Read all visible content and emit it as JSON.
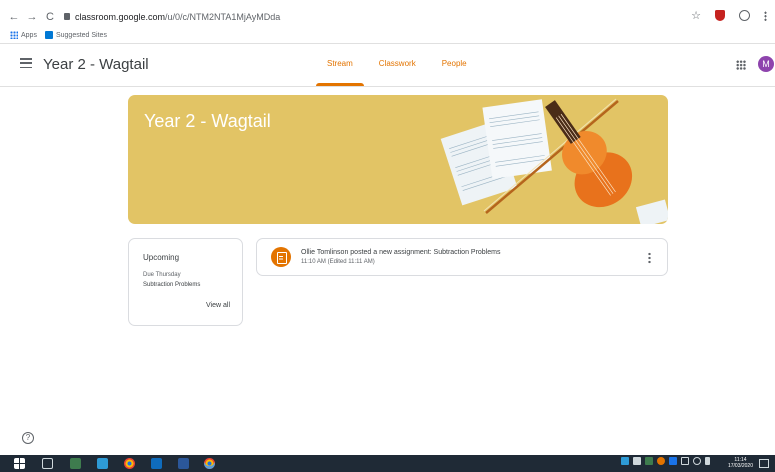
{
  "browser": {
    "url_domain": "classroom.google.com",
    "url_path": "/u/0/c/NTM2NTA1MjAyMDda",
    "back_icon": "←",
    "forward_icon": "→",
    "reload_icon": "C",
    "star_icon": "☆",
    "bookmarks": [
      {
        "label": "Apps",
        "icon": "apps-grid-icon"
      },
      {
        "label": "Suggested Sites",
        "icon": "bing-icon"
      }
    ]
  },
  "header": {
    "class_name": "Year 2 - Wagtail",
    "tabs": [
      {
        "label": "Stream",
        "active": true
      },
      {
        "label": "Classwork",
        "active": false
      },
      {
        "label": "People",
        "active": false
      }
    ],
    "avatar_initial": "M",
    "avatar_color": "#8e44ad"
  },
  "banner": {
    "title": "Year 2 - Wagtail",
    "color": "#e2c465"
  },
  "upcoming": {
    "title": "Upcoming",
    "due": "Due Thursday",
    "item": "Subtraction Problems",
    "view_all": "View all"
  },
  "post": {
    "title": "Ollie Tomlinson posted a new assignment: Subtraction Problems",
    "time": "11:10 AM (Edited 11:11 AM)",
    "accent": "#e37400"
  },
  "help_icon": "?",
  "taskbar": {
    "time": "11:14",
    "date": "17/03/2020"
  }
}
